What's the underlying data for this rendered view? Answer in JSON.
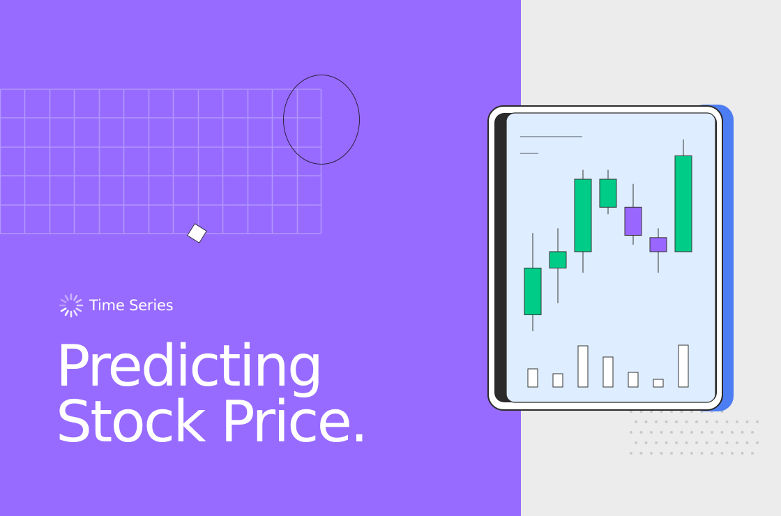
{
  "tag": {
    "label": "Time Series",
    "icon": "loading-spinner-icon"
  },
  "headline": {
    "line1": "Predicting",
    "line2": "Stock Price."
  },
  "colors": {
    "left_panel": "#976bff",
    "right_panel": "#ececec",
    "candle_up": "#00cc88",
    "candle_down": "#9966ff",
    "screen": "#deedff",
    "tablet_edge": "#4d7df2"
  },
  "chart_data": {
    "type": "candlestick",
    "candles": [
      {
        "open": 30,
        "close": 50,
        "high": 65,
        "low": 23,
        "direction": "up"
      },
      {
        "open": 50,
        "close": 57,
        "high": 67,
        "low": 35,
        "direction": "up"
      },
      {
        "open": 57,
        "close": 88,
        "high": 92,
        "low": 48,
        "direction": "up"
      },
      {
        "open": 76,
        "close": 88,
        "high": 92,
        "low": 73,
        "direction": "up"
      },
      {
        "open": 76,
        "close": 64,
        "high": 86,
        "low": 60,
        "direction": "down"
      },
      {
        "open": 63,
        "close": 57,
        "high": 67,
        "low": 48,
        "direction": "down"
      },
      {
        "open": 57,
        "close": 98,
        "high": 105,
        "low": 57,
        "direction": "up"
      }
    ],
    "volume": [
      26,
      19,
      59,
      43,
      21,
      11,
      60
    ]
  }
}
